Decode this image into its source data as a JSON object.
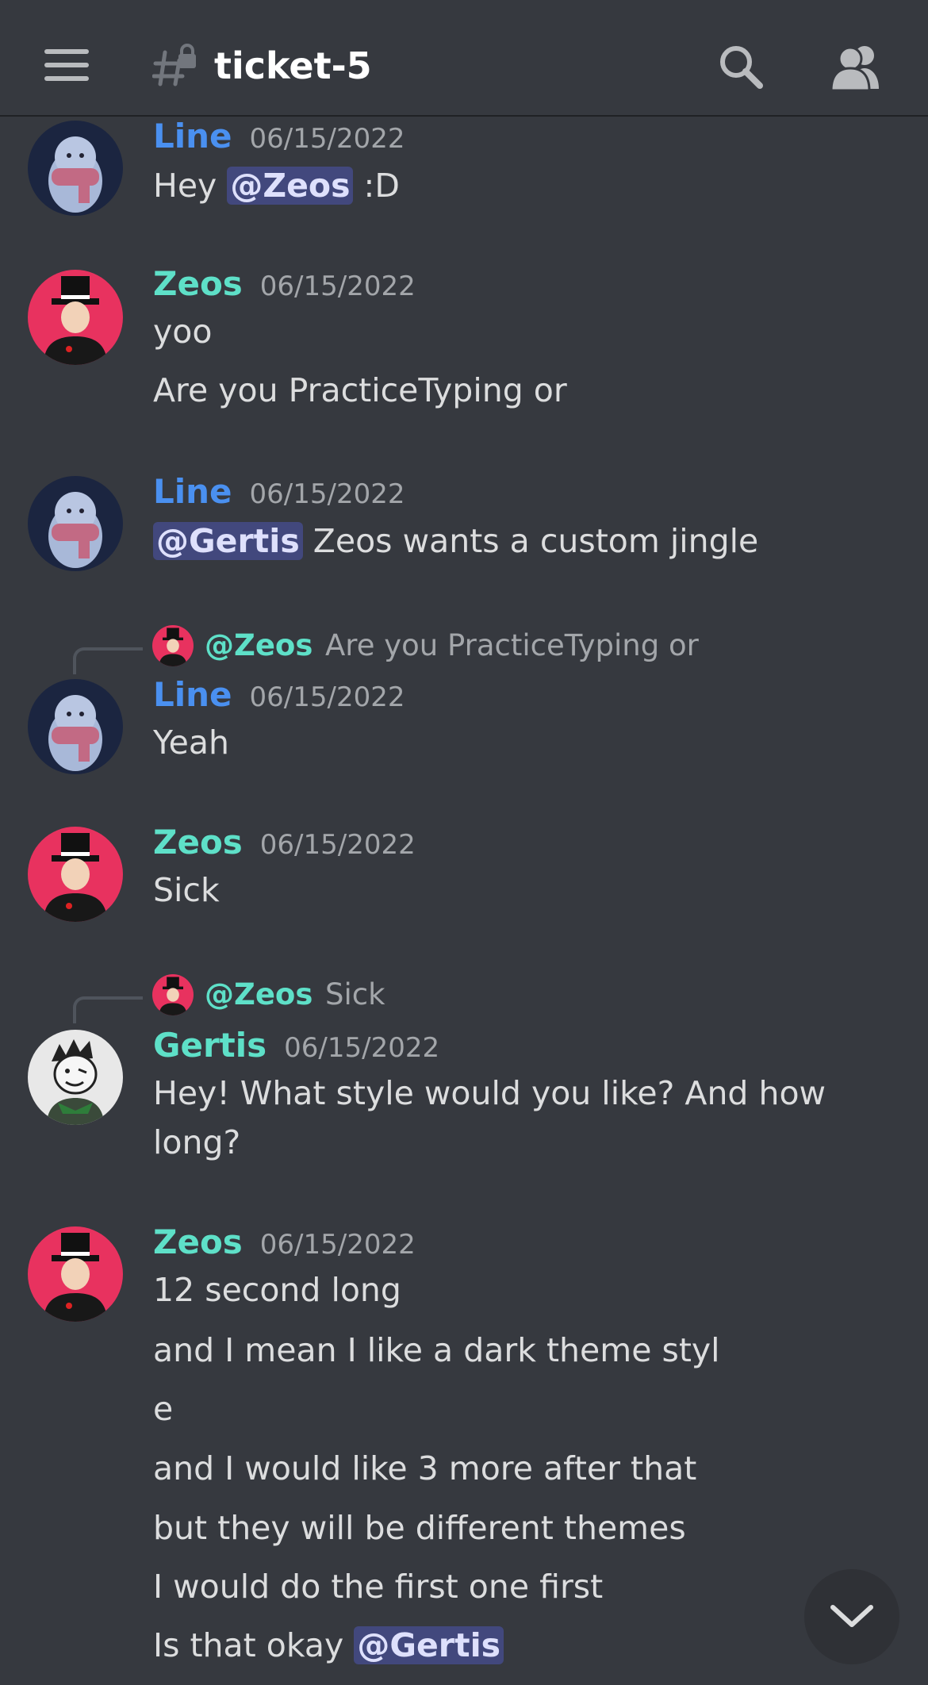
{
  "header": {
    "channel_name": "ticket-5",
    "menu_icon": "hamburger-menu-icon",
    "channel_icon": "locked-hash-icon",
    "search_icon": "search-icon",
    "members_icon": "members-icon"
  },
  "colors": {
    "background": "#36393f",
    "line_name": "#4a90f0",
    "zeos_name": "#5ee0c8",
    "gertis_name": "#5ee0c8",
    "mention_bg": "#4f5aa0"
  },
  "messages": [
    {
      "author": "Line",
      "timestamp": "06/15/2022",
      "lines": [
        {
          "pre": "Hey ",
          "mention": "@Zeos",
          "post": " :D"
        }
      ]
    },
    {
      "author": "Zeos",
      "timestamp": "06/15/2022",
      "lines": [
        "yoo",
        "Are you PracticeTyping or"
      ]
    },
    {
      "author": "Line",
      "timestamp": "06/15/2022",
      "lines": [
        {
          "pre": "",
          "mention": "@Gertis",
          "post": " Zeos wants a custom jingle"
        }
      ]
    },
    {
      "reply_to": {
        "name": "@Zeos",
        "text": "Are you PracticeTyping or"
      },
      "author": "Line",
      "timestamp": "06/15/2022",
      "lines": [
        "Yeah"
      ]
    },
    {
      "author": "Zeos",
      "timestamp": "06/15/2022",
      "lines": [
        "Sick"
      ]
    },
    {
      "reply_to": {
        "name": "@Zeos",
        "text": "Sick"
      },
      "author": "Gertis",
      "timestamp": "06/15/2022",
      "lines": [
        "Hey! What style would you like? And how",
        "long?"
      ]
    },
    {
      "author": "Zeos",
      "timestamp": "06/15/2022",
      "lines": [
        "12 second long",
        "and I mean I like a dark theme styl",
        "e",
        "and I would like 3 more after that",
        "but they will be different themes",
        "I would do the first one first",
        {
          "pre": "Is that okay ",
          "mention": "@Gertis",
          "post": ""
        }
      ]
    }
  ],
  "scroll_button_icon": "chevron-down-icon"
}
